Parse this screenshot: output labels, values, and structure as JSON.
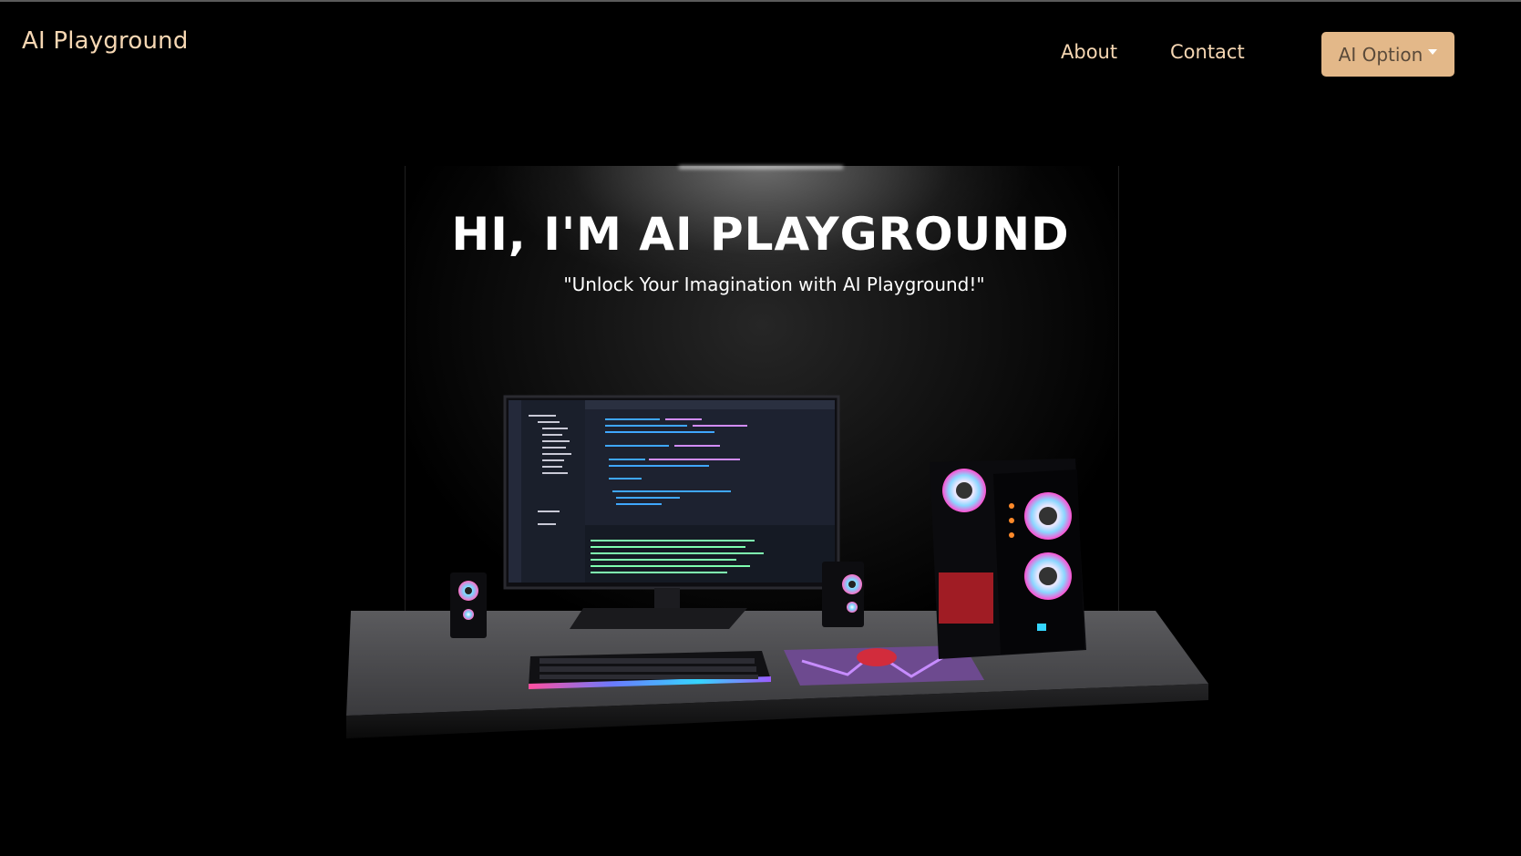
{
  "header": {
    "brand": "AI Playground",
    "nav": {
      "about": "About",
      "contact": "Contact"
    },
    "ai_option_label": "AI Option"
  },
  "hero": {
    "title": "HI, I'M AI PLAYGROUND",
    "subtitle": "\"Unlock Your Imagination with AI Playground!\""
  },
  "colors": {
    "background": "#000000",
    "brand_text": "#f6d7b3",
    "accent_button": "#e3b889"
  }
}
